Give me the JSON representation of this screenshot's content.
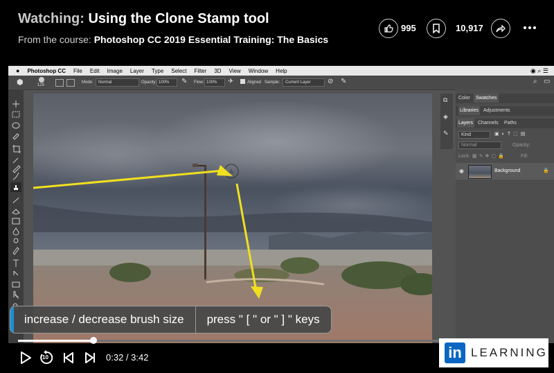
{
  "header": {
    "watching_prefix": "Watching:",
    "video_title": "Using the Clone Stamp tool",
    "course_prefix": "From the course:",
    "course_title": "Photoshop CC 2019 Essential Training: The Basics",
    "likes": "995",
    "saves": "10,917"
  },
  "photoshop": {
    "app_name": "Photoshop CC",
    "menus": [
      "File",
      "Edit",
      "Image",
      "Layer",
      "Type",
      "Select",
      "Filter",
      "3D",
      "View",
      "Window",
      "Help"
    ],
    "options": {
      "brush_size": "125",
      "mode_label": "Mode:",
      "mode_value": "Normal",
      "opacity_label": "Opacity:",
      "opacity_value": "100%",
      "flow_label": "Flow:",
      "flow_value": "100%",
      "aligned_label": "Aligned",
      "sample_label": "Sample:",
      "sample_value": "Current Layer"
    },
    "panel_tabs_row1": [
      "Color",
      "Swatches"
    ],
    "panel_tabs_row2": [
      "Libraries",
      "Adjustments"
    ],
    "panel_tabs_row3": [
      "Layers",
      "Channels",
      "Paths"
    ],
    "layers": {
      "kind_label": "Kind",
      "blend_mode": "Normal",
      "opacity_label": "Opacity:",
      "lock_label": "Lock:",
      "fill_label": "Fill:",
      "layer_name": "Background"
    }
  },
  "caption": {
    "part1": "increase / decrease brush size",
    "part2": "press \" [ \" or \" ] \" keys"
  },
  "player": {
    "progress": 0.178,
    "current_time": "0:32",
    "duration": "3:42",
    "time_separator": " / ",
    "skip_seconds": "10"
  },
  "brand": {
    "logo_in": "in",
    "logo_text": "LEARNING",
    "color": "#0a66c2"
  },
  "colors": {
    "annotation_arrow": "#f0e020",
    "caption_accent": "#1b8fd6"
  }
}
